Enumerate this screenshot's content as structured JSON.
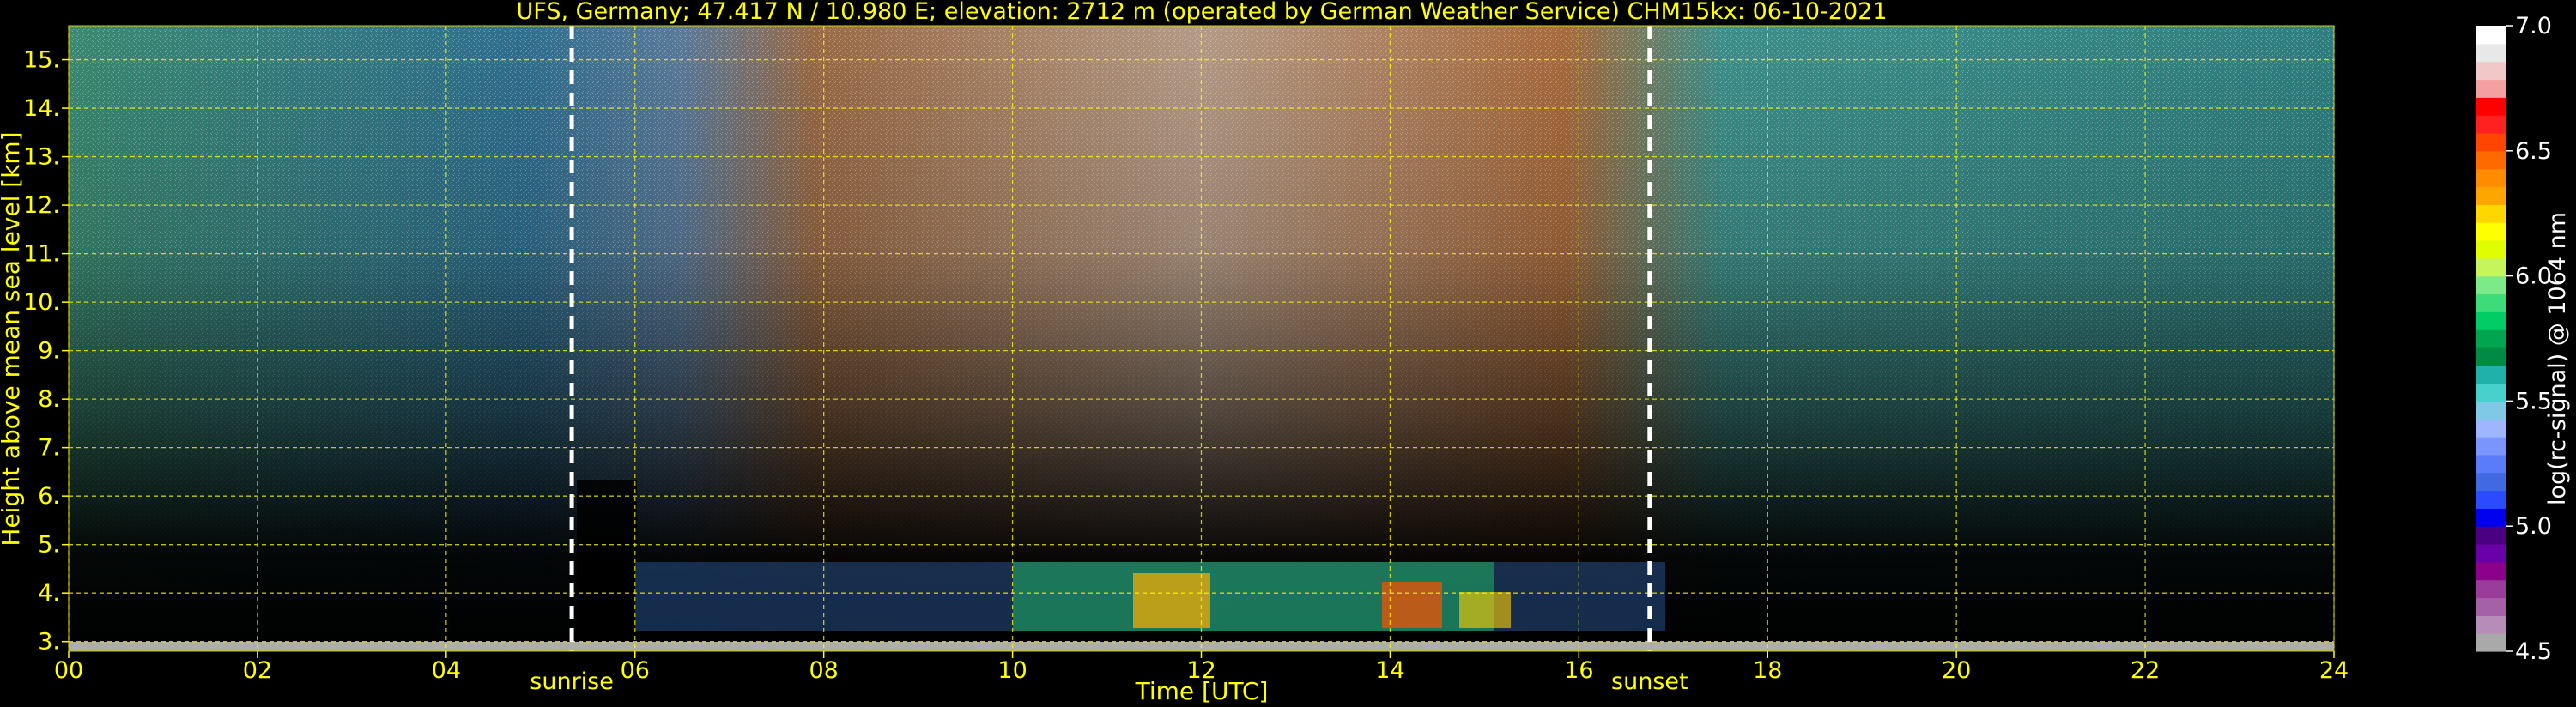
{
  "chart_data": {
    "type": "heatmap",
    "title": "UFS, Germany; 47.417 N / 10.980 E; elevation: 2712 m  (operated by German Weather Service)    CHM15kx: 06-10-2021",
    "xlabel": "Time [UTC]",
    "ylabel": "Height above mean sea level [km]",
    "xlim": [
      0,
      24
    ],
    "ylim": [
      2.8,
      15.7
    ],
    "x_ticks": [
      "00",
      "02",
      "04",
      "06",
      "08",
      "10",
      "12",
      "14",
      "16",
      "18",
      "20",
      "22",
      "24"
    ],
    "y_ticks": [
      "3.",
      "4.",
      "5.",
      "6.",
      "7.",
      "8.",
      "9.",
      "10.",
      "11.",
      "12.",
      "13.",
      "14.",
      "15."
    ],
    "grid": true,
    "grid_color": "#ffff00",
    "annotations": [
      {
        "text": "sunrise",
        "x": 5.33
      },
      {
        "text": "sunset",
        "x": 16.75
      }
    ],
    "colorbar": {
      "label": "log(rc-signal) @ 1064 nm",
      "range": [
        4.5,
        7.0
      ],
      "ticks": [
        "4.5",
        "5.0",
        "5.5",
        "6.0",
        "6.5",
        "7.0"
      ],
      "colors": [
        "#a9a9a9",
        "#b68db6",
        "#a561a5",
        "#9a3d9a",
        "#8b008b",
        "#6a00a8",
        "#4b0082",
        "#0000ee",
        "#2a4bff",
        "#4169e1",
        "#5b7cfa",
        "#7b95ff",
        "#9fb5ff",
        "#7fc9e6",
        "#48d1cc",
        "#20b2aa",
        "#008b45",
        "#00a550",
        "#00cd66",
        "#3cdc78",
        "#7dea8a",
        "#c5f55a",
        "#dfff00",
        "#ffff00",
        "#ffd700",
        "#ffa500",
        "#ff8c00",
        "#ff6a00",
        "#ff4500",
        "#ff2020",
        "#ff0000",
        "#f4a0a0",
        "#f0c8c8",
        "#e8e8e8",
        "#ffffff"
      ]
    }
  }
}
